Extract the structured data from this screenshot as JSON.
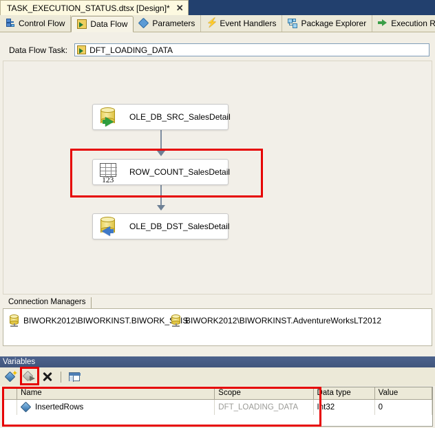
{
  "document_tab": {
    "title": "TASK_EXECUTION_STATUS.dtsx [Design]*",
    "close_label": "✕"
  },
  "designer_tabs": [
    {
      "label": "Control Flow",
      "icon": "control-flow-icon",
      "active": false
    },
    {
      "label": "Data Flow",
      "icon": "data-flow-icon",
      "active": true
    },
    {
      "label": "Parameters",
      "icon": "parameters-icon",
      "active": false
    },
    {
      "label": "Event Handlers",
      "icon": "event-handlers-icon",
      "active": false
    },
    {
      "label": "Package Explorer",
      "icon": "package-explorer-icon",
      "active": false
    },
    {
      "label": "Execution Results",
      "icon": "execution-results-icon",
      "active": false
    }
  ],
  "data_flow_task": {
    "label": "Data Flow Task:",
    "selected": "DFT_LOADING_DATA",
    "icon": "data-flow-icon"
  },
  "canvas": {
    "components": [
      {
        "name": "OLE_DB_SRC_SalesDetail",
        "type": "ole-db-source",
        "icon": "db-source-icon"
      },
      {
        "name": "ROW_COUNT_SalesDetail",
        "type": "row-count",
        "icon": "row-count-icon",
        "icon_number": "123"
      },
      {
        "name": "OLE_DB_DST_SalesDetail",
        "type": "ole-db-destination",
        "icon": "db-destination-icon"
      }
    ],
    "highlight_color": "#e60000"
  },
  "connection_managers": {
    "tab_label": "Connection Managers",
    "items": [
      "BIWORK2012\\BIWORKINST.BIWORK_SSIS",
      "BIWORK2012\\BIWORKINST.AdventureWorksLT2012"
    ]
  },
  "variables": {
    "title": "Variables",
    "toolbar": [
      {
        "name": "add-variable-button",
        "tooltip": "Add Variable"
      },
      {
        "name": "map-variable-button",
        "tooltip": "Map Variable"
      },
      {
        "name": "delete-variable-button",
        "tooltip": "Delete Variable"
      },
      {
        "name": "grid-options-button",
        "tooltip": "Grid Options"
      }
    ],
    "columns": [
      "Name",
      "Scope",
      "Data type",
      "Value"
    ],
    "rows": [
      {
        "name": "InsertedRows",
        "scope": "DFT_LOADING_DATA",
        "data_type": "Int32",
        "value": "0"
      }
    ]
  }
}
